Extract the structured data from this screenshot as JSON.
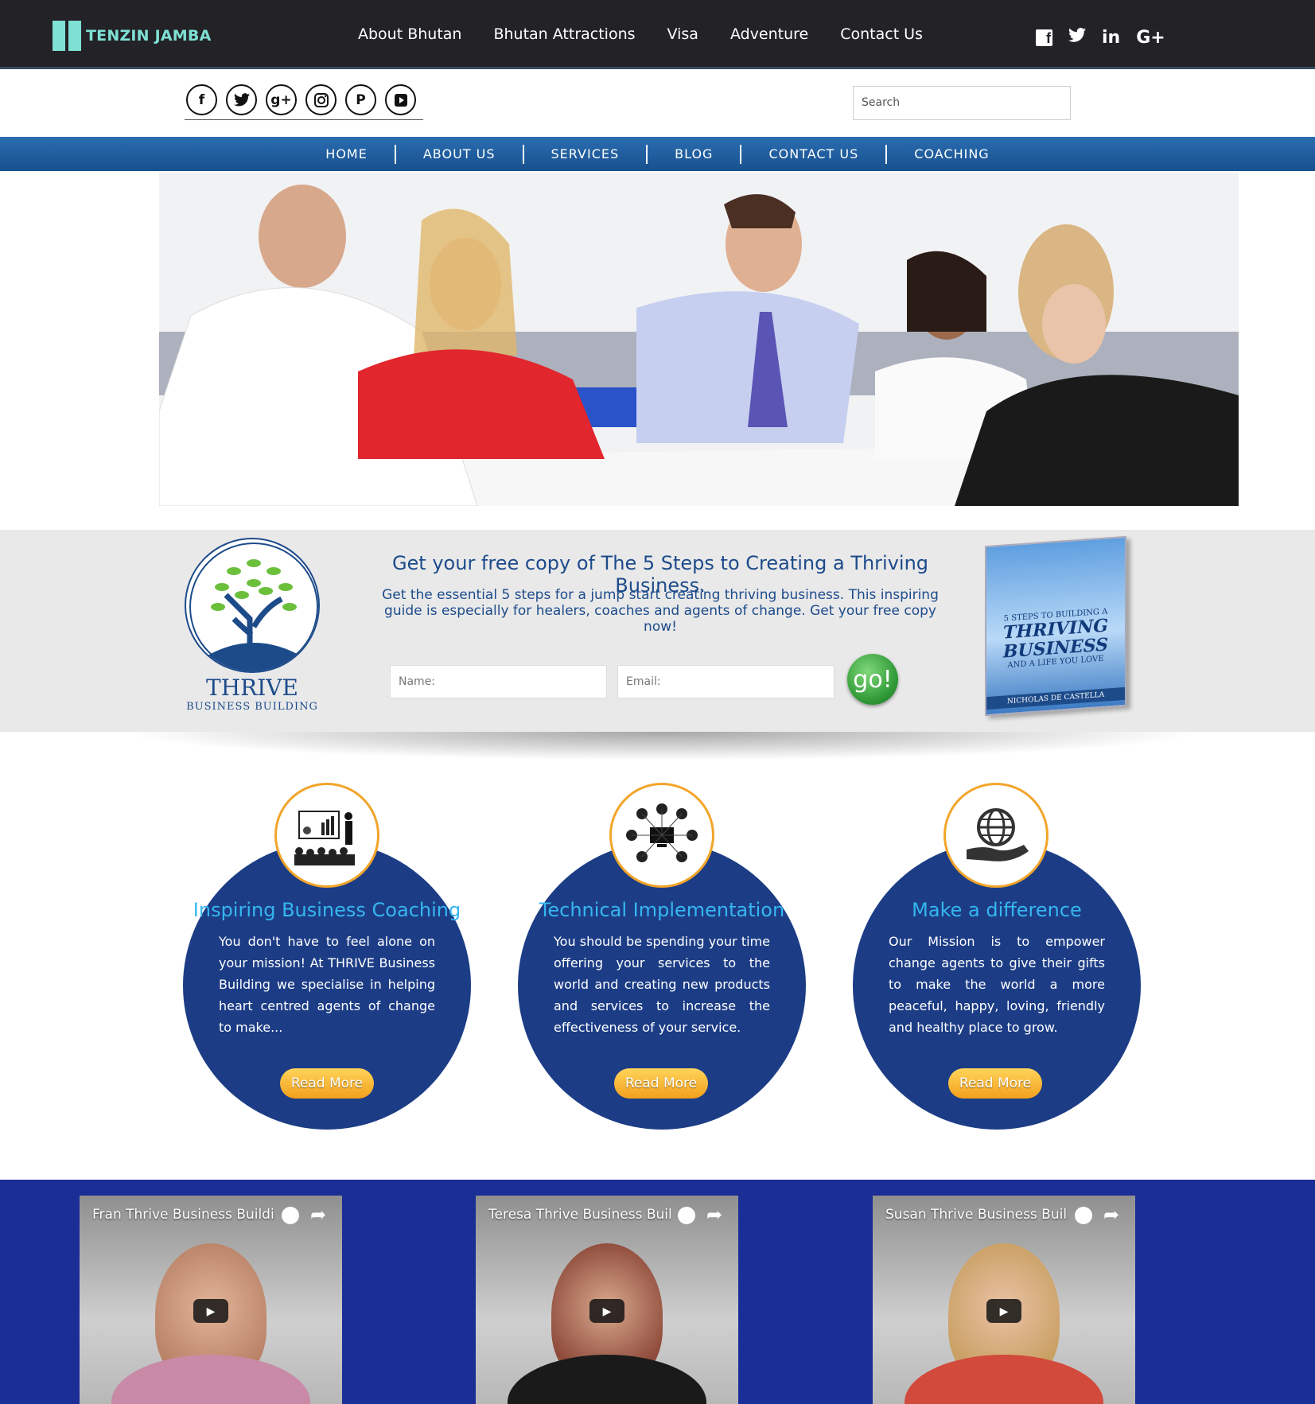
{
  "topbar": {
    "logo_text": "TENZIN JAMBA",
    "nav": [
      "About Bhutan",
      "Bhutan Attractions",
      "Visa",
      "Adventure",
      "Contact Us"
    ],
    "social": [
      "facebook-icon",
      "twitter-icon",
      "linkedin-icon",
      "google-plus-icon"
    ],
    "social_glyphs": {
      "linkedin": "in",
      "googleplus": "G+"
    }
  },
  "social_row": {
    "icons": [
      "facebook-icon",
      "twitter-icon",
      "google-plus-icon",
      "instagram-icon",
      "pinterest-icon",
      "youtube-icon"
    ],
    "glyphs": [
      "f",
      "🐦",
      "g+",
      "◎",
      "P",
      "▶"
    ]
  },
  "search": {
    "placeholder": "Search"
  },
  "main_nav": [
    "HOME",
    "ABOUT US",
    "SERVICES",
    "BLOG",
    "CONTACT US",
    "COACHING"
  ],
  "optin": {
    "logo_title": "THRIVE",
    "logo_subtitle": "BUSINESS BUILDING",
    "heading": "Get your free copy of The 5 Steps to Creating a Thriving Business.",
    "description": "Get the essential 5 steps for a jump start creating thriving business. This inspiring guide is especially for healers, coaches and agents of change. Get your free copy now!",
    "name_placeholder": "Name:",
    "email_placeholder": "Email:",
    "go_label": "go!",
    "book": {
      "line1": "5 STEPS TO BUILDING A",
      "line2": "THRIVING BUSINESS",
      "line3": "AND A LIFE YOU LOVE",
      "author": "NICHOLAS DE CASTELLA"
    }
  },
  "services": [
    {
      "title": "Inspiring Business Coaching",
      "text": "You don't have to feel alone on your mission! At THRIVE Business Building we specialise in helping heart centred agents of change to make...",
      "button": "Read More",
      "icon": "presentation-icon"
    },
    {
      "title": "Technical Implementation",
      "text": "You should be spending your time offering your services to the world and creating new products and services to increase the effectiveness of your service.",
      "button": "Read More",
      "icon": "network-devices-icon"
    },
    {
      "title": "Make a difference",
      "text": "Our Mission is to empower change agents to give their gifts to make the world a more peaceful, happy, loving, friendly and healthy place to grow.",
      "button": "Read More",
      "icon": "globe-in-hand-icon"
    }
  ],
  "videos": [
    {
      "title": "Fran Thrive Business Buildi..."
    },
    {
      "title": "Teresa Thrive Business Buil..."
    },
    {
      "title": "Susan Thrive Business Buil..."
    }
  ],
  "colors": {
    "topbar": "#222227",
    "accent_teal": "#7fe0d4",
    "nav_blue": "#18508f",
    "card_blue": "#1c3d86",
    "title_cyan": "#36b6ef",
    "button_orange": "#f3a01c",
    "video_band": "#1b2e96"
  }
}
